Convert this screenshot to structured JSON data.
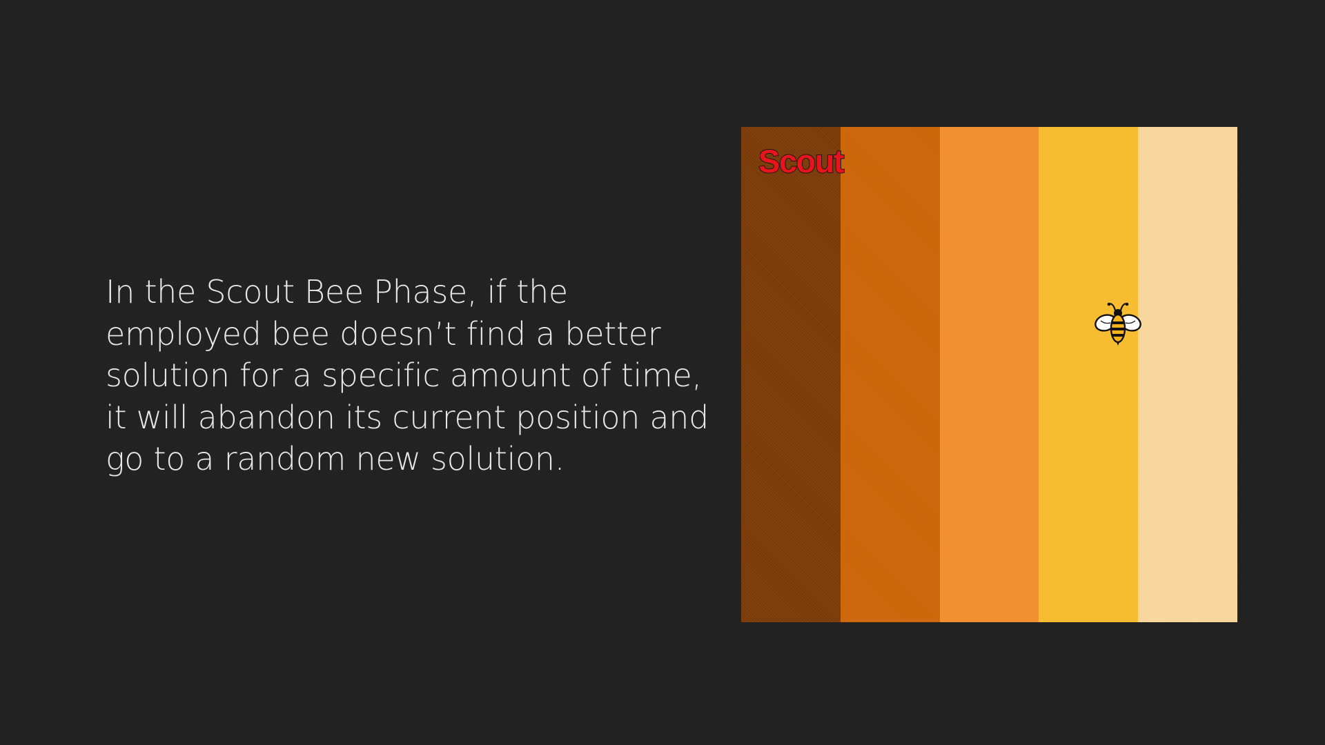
{
  "slide": {
    "text": "In the Scout Bee Phase, if the employed bee doesn’t find a better solution for a specific amount of time, it will abandon its current position and go to a random new solution."
  },
  "panel": {
    "label": "Scout",
    "label_color": "#e8141c",
    "stripes": [
      "#7a3a08",
      "#cc6508",
      "#f28e2e",
      "#f7bc2e",
      "#f8d69b"
    ],
    "bee_icon": "bee-icon"
  },
  "colors": {
    "background": "#222222",
    "text": "#e8e8e8"
  }
}
